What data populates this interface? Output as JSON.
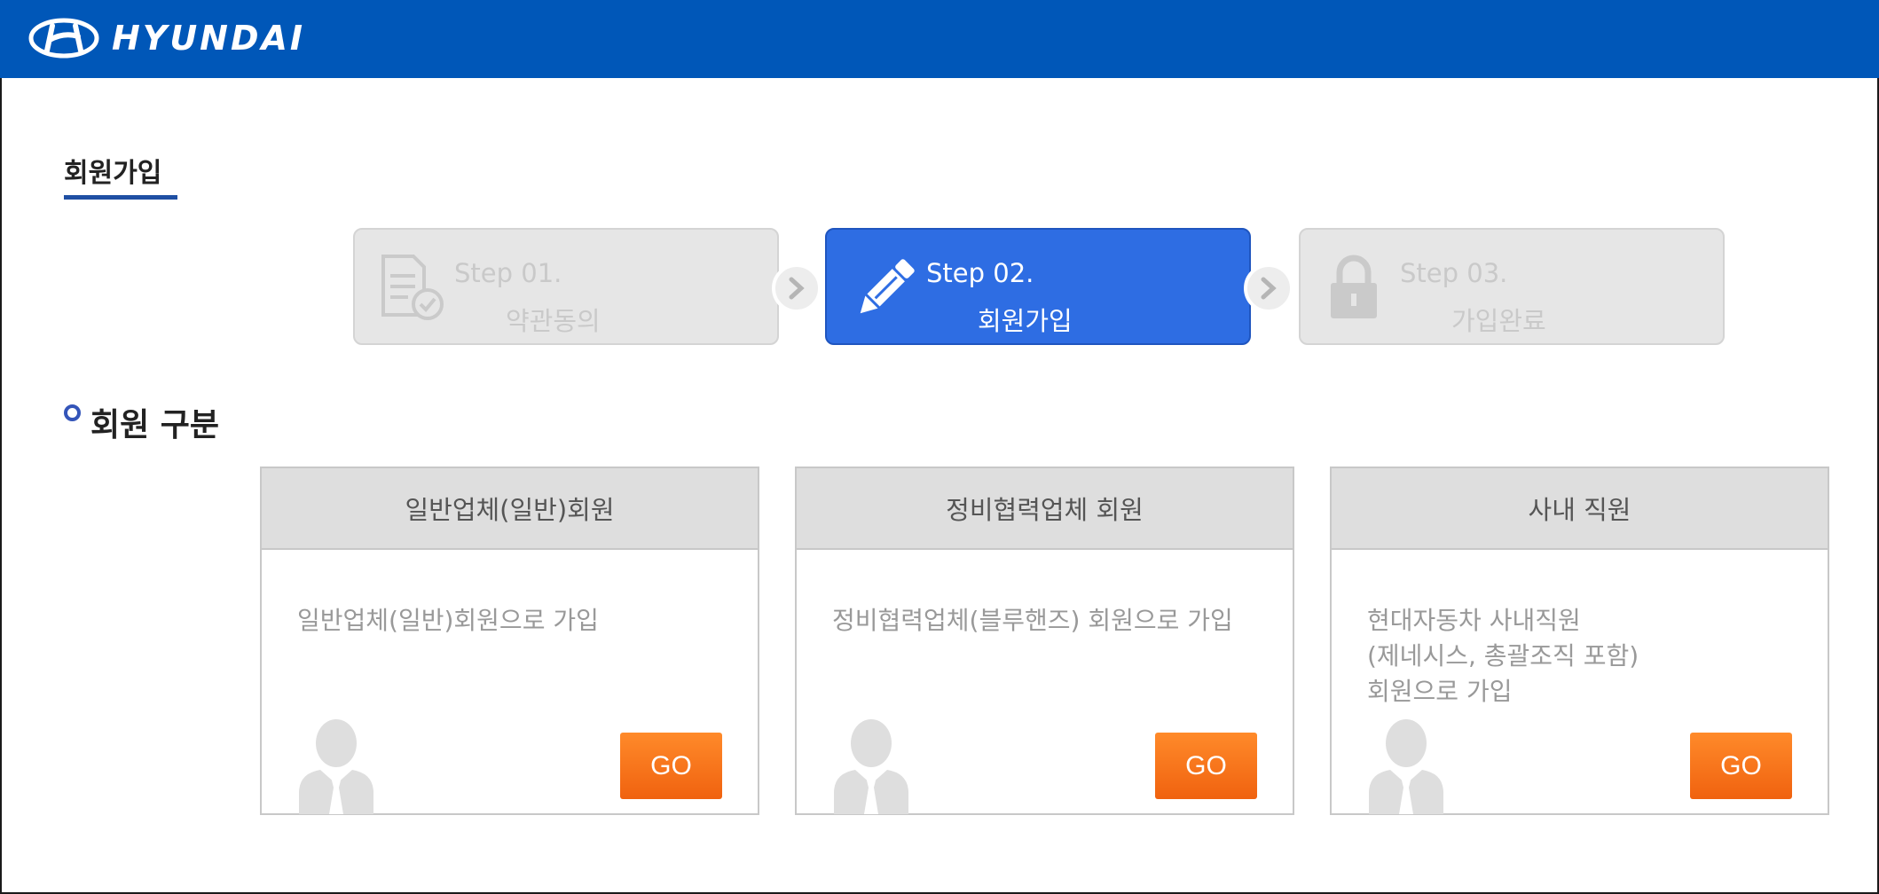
{
  "brand": {
    "logo_text": "HYUNDAI"
  },
  "page": {
    "title": "회원가입"
  },
  "steps": [
    {
      "number": "Step 01.",
      "label": "약관동의",
      "icon": "document-check-icon",
      "active": false
    },
    {
      "number": "Step 02.",
      "label": "회원가입",
      "icon": "pencil-icon",
      "active": true
    },
    {
      "number": "Step 03.",
      "label": "가입완료",
      "icon": "lock-icon",
      "active": false
    }
  ],
  "section": {
    "title": "회원 구분"
  },
  "cards": [
    {
      "title": "일반업체(일반)회원",
      "description": "일반업체(일반)회원으로 가입",
      "button": "GO",
      "icon": "user-avatar-icon"
    },
    {
      "title": "정비협력업체 회원",
      "description": "정비협력업체(블루핸즈) 회원으로 가입",
      "button": "GO",
      "icon": "user-avatar-icon"
    },
    {
      "title": "사내 직원",
      "description": "현대자동차 사내직원\n(제네시스, 총괄조직 포함)\n회원으로 가입",
      "button": "GO",
      "icon": "user-avatar-icon"
    }
  ],
  "colors": {
    "header": "#0057b8",
    "active_step": "#2e6de3",
    "go_button": "#f26a12"
  }
}
